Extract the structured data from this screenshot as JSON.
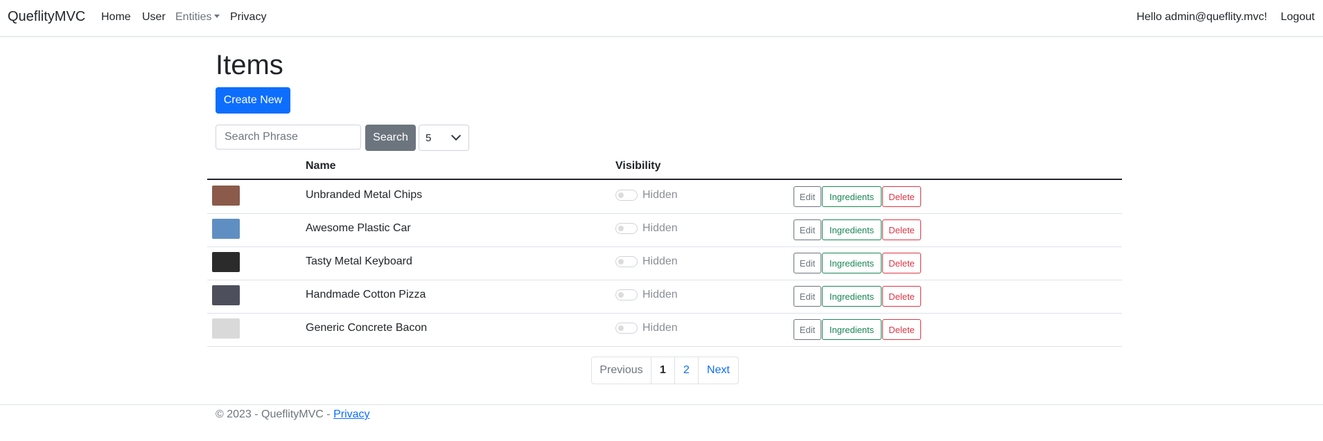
{
  "navbar": {
    "brand": "QueflityMVC",
    "links": [
      "Home",
      "User",
      "Entities",
      "Privacy"
    ],
    "greeting": "Hello admin@queflity.mvc!",
    "logout": "Logout"
  },
  "page": {
    "title": "Items",
    "create_new": "Create New"
  },
  "search": {
    "placeholder": "Search Phrase",
    "button": "Search",
    "page_size": "5"
  },
  "table": {
    "headers": [
      "",
      "Name",
      "Visibility",
      ""
    ],
    "rows": [
      {
        "name": "Unbranded Metal Chips",
        "visibility": "Hidden",
        "thumb_color": "#8b5a4a"
      },
      {
        "name": "Awesome Plastic Car",
        "visibility": "Hidden",
        "thumb_color": "#5f8fc2"
      },
      {
        "name": "Tasty Metal Keyboard",
        "visibility": "Hidden",
        "thumb_color": "#2b2b2b"
      },
      {
        "name": "Handmade Cotton Pizza",
        "visibility": "Hidden",
        "thumb_color": "#4d4f5c"
      },
      {
        "name": "Generic Concrete Bacon",
        "visibility": "Hidden",
        "thumb_color": "#d9d9d9"
      }
    ],
    "actions": {
      "edit": "Edit",
      "ingredients": "Ingredients",
      "delete": "Delete"
    }
  },
  "pagination": {
    "previous": "Previous",
    "pages": [
      "1",
      "2"
    ],
    "active_page": "1",
    "next": "Next"
  },
  "footer": {
    "text": "© 2023 - QueflityMVC - ",
    "privacy": "Privacy"
  },
  "colors": {
    "primary": "#0d6efd",
    "secondary": "#6c757d",
    "success": "#198754",
    "danger": "#dc3545"
  }
}
